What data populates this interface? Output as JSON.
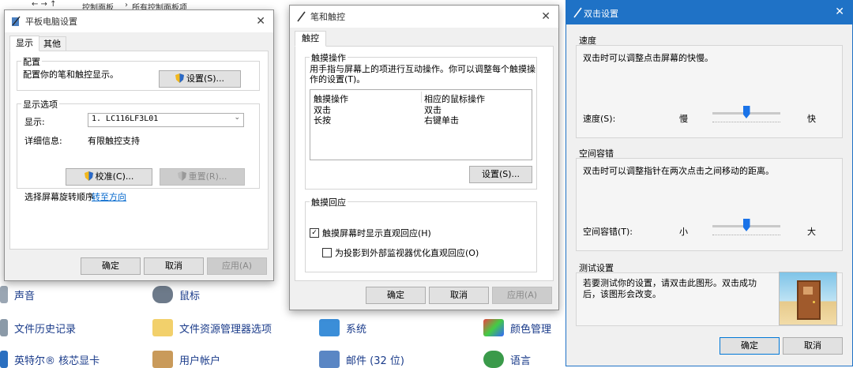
{
  "control_panel": {
    "breadcrumb": [
      "控制面板",
      "所有控制面板项"
    ],
    "items_row1": [
      "声音",
      "鼠标"
    ],
    "items_row2": [
      "文件历史记录",
      "文件资源管理器选项",
      "系统",
      "颜色管理"
    ],
    "items_row3": [
      "英特尔® 核芯显卡",
      "用户帐户",
      "邮件 (32 位)",
      "语言"
    ]
  },
  "tablet": {
    "title": "平板电脑设置",
    "tabs": [
      "显示",
      "其他"
    ],
    "config_group": "配置",
    "config_desc": "配置你的笔和触控显示。",
    "settings_btn": "设置(S)...",
    "display_group": "显示选项",
    "display_label": "显示:",
    "display_value": "1. LC116LF3L01",
    "detail_label": "详细信息:",
    "detail_value": "有限触控支持",
    "calibrate_btn": "校准(C)...",
    "reset_btn": "重置(R)...",
    "rotation_text": "选择屏幕旋转顺序",
    "rotation_link": "转至方向",
    "ok": "确定",
    "cancel": "取消",
    "apply": "应用(A)"
  },
  "pen": {
    "title": "笔和触控",
    "tab": "触控",
    "actions_group": "触摸操作",
    "actions_desc": "用手指与屏幕上的项进行互动操作。你可以调整每个触摸操作的设置(T)。",
    "col1": "触摸操作",
    "col2": "相应的鼠标操作",
    "rows": [
      {
        "action": "双击",
        "mouse": "双击"
      },
      {
        "action": "长按",
        "mouse": "右键单击"
      }
    ],
    "settings_btn": "设置(S)...",
    "feedback_group": "触摸回应",
    "check1": "触摸屏幕时显示直观回应(H)",
    "check1_checked": true,
    "check2": "为投影到外部监视器优化直观回应(O)",
    "check2_checked": false,
    "ok": "确定",
    "cancel": "取消",
    "apply": "应用(A)"
  },
  "dbl": {
    "title": "双击设置",
    "speed_title": "速度",
    "speed_desc": "双击时可以调整点击屏幕的快慢。",
    "speed_label": "速度(S):",
    "speed_slow": "慢",
    "speed_fast": "快",
    "speed_level": 0.5,
    "space_title": "空间容错",
    "space_desc": "双击时可以调整指针在两次点击之间移动的距离。",
    "space_label": "空间容错(T):",
    "space_small": "小",
    "space_large": "大",
    "space_level": 0.5,
    "test_title": "测试设置",
    "test_desc": "若要测试你的设置，请双击此图形。双击成功后，该图形会改变。",
    "ok": "确定",
    "cancel": "取消"
  },
  "colors": {
    "accent": "#1f72c6",
    "link": "#0066cc"
  }
}
